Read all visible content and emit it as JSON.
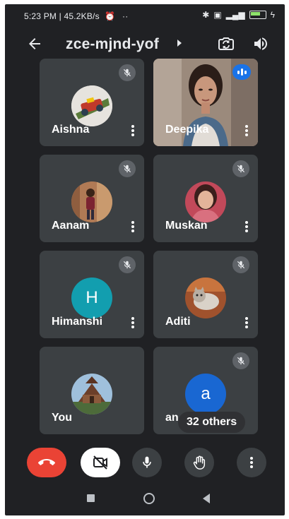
{
  "status_bar": {
    "left_text": "5:23 PM | 45.2KB/s",
    "right_icons": [
      "bluetooth-icon",
      "vibrate-icon",
      "signal-icon",
      "battery-icon",
      "charging-icon"
    ]
  },
  "header": {
    "meeting_code": "zce-mjnd-yof"
  },
  "participants": [
    {
      "name": "Aishna",
      "muted": true,
      "avatar": "image"
    },
    {
      "name": "Deepika",
      "muted": false,
      "avatar": "video",
      "speaking": true
    },
    {
      "name": "Aanam",
      "muted": true,
      "avatar": "image"
    },
    {
      "name": "Muskan",
      "muted": true,
      "avatar": "image"
    },
    {
      "name": "Himanshi",
      "muted": true,
      "avatar": "letter",
      "letter": "H",
      "color": "#129eaf"
    },
    {
      "name": "Aditi",
      "muted": true,
      "avatar": "image"
    },
    {
      "name": "You",
      "muted": false,
      "avatar": "image"
    },
    {
      "name": "an",
      "muted": true,
      "avatar": "letter",
      "letter": "a",
      "color": "#1967d2"
    }
  ],
  "others_label": "32 others",
  "controls": {
    "end_call": "end-call-icon",
    "camera": "camera-off-icon",
    "mic": "mic-icon",
    "raise_hand": "raise-hand-icon",
    "more": "more-vert-icon"
  },
  "colors": {
    "background": "#202124",
    "tile": "#3c4043",
    "end_call": "#ea4335",
    "speaking": "#1a73e8"
  }
}
